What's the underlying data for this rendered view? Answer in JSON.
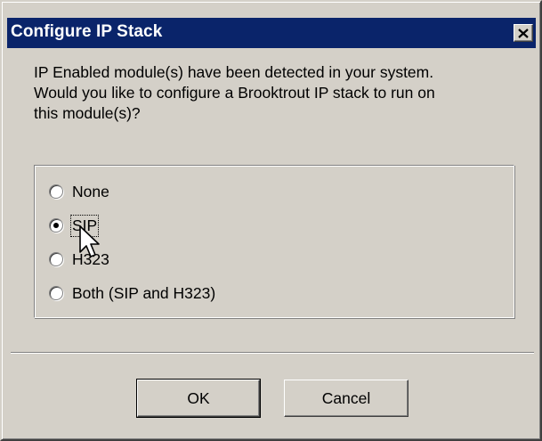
{
  "dialog": {
    "title": "Configure IP Stack",
    "close_glyph": "×",
    "message": "IP Enabled module(s) have been detected in your system.\nWould you like to configure a Brooktrout IP stack to run on\nthis module(s)?",
    "options": [
      {
        "label": "None",
        "checked": false
      },
      {
        "label": "SIP",
        "checked": true
      },
      {
        "label": "H323",
        "checked": false
      },
      {
        "label": "Both (SIP and H323)",
        "checked": false
      }
    ],
    "ok_label": "OK",
    "cancel_label": "Cancel"
  },
  "icons": {
    "close": "close-icon",
    "cursor": "mouse-pointer-icon"
  },
  "colors": {
    "titlebar": "#0a246a",
    "face": "#d4d0c8",
    "title_text": "#ffffff"
  }
}
